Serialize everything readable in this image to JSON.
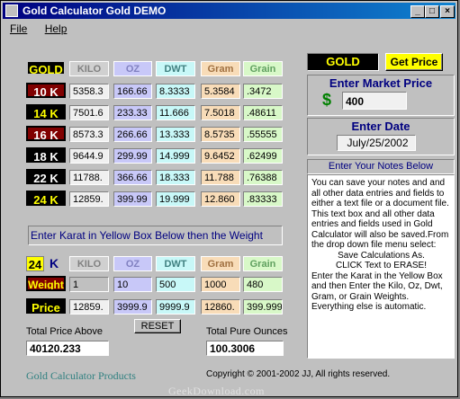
{
  "window": {
    "title": "Gold Calculator Gold DEMO"
  },
  "menu": {
    "file": "File",
    "help": "Help"
  },
  "table": {
    "gold_label": "GOLD",
    "headers": [
      "KILO",
      "OZ",
      "DWT",
      "Gram",
      "Grain"
    ],
    "rows": [
      {
        "karat": "10 K",
        "values": [
          "5358.3",
          "166.66",
          "8.3333",
          "5.3584",
          ".3472"
        ]
      },
      {
        "karat": "14 K",
        "values": [
          "7501.6",
          "233.33",
          "11.666",
          "7.5018",
          ".48611"
        ]
      },
      {
        "karat": "16 K",
        "values": [
          "8573.3",
          "266.66",
          "13.333",
          "8.5735",
          ".55555"
        ]
      },
      {
        "karat": "18 K",
        "values": [
          "9644.9",
          "299.99",
          "14.999",
          "9.6452",
          ".62499"
        ]
      },
      {
        "karat": "22 K",
        "values": [
          "11788.",
          "366.66",
          "18.333",
          "11.788",
          ".76388"
        ]
      },
      {
        "karat": "24 K",
        "values": [
          "12859.",
          "399.99",
          "19.999",
          "12.860",
          ".83333"
        ]
      }
    ]
  },
  "message": "Enter Karat in Yellow Box Below then the Weight",
  "input": {
    "karat_value": "24",
    "karat_unit": "K",
    "headers": [
      "KILO",
      "OZ",
      "DWT",
      "Gram",
      "Grain"
    ],
    "weight_label": "Weight",
    "weights": [
      "1",
      "10",
      "500",
      "1000",
      "480"
    ],
    "price_label": "Price",
    "prices": [
      "12859.",
      "3999.9",
      "9999.9",
      "12860.",
      "399.999"
    ]
  },
  "reset_label": "RESET",
  "totals": {
    "price_label": "Total Price Above",
    "price_value": "40120.233",
    "ounces_label": "Total Pure Ounces",
    "ounces_value": "100.3006"
  },
  "market": {
    "metal": "GOLD",
    "get_price": "Get Price",
    "title": "Enter Market Price",
    "currency": "$",
    "price": "400",
    "date_title": "Enter Date",
    "date": "July/25/2002",
    "notes_title": "Enter Your Notes Below"
  },
  "notes": {
    "lines": [
      "You can save your notes and and all other data entries and fields to either a text file or a document file. This text box and all other data entries and fields used in Gold Calculator will also be saved.From the drop down file menu select:",
      "Save Calculations As.",
      "CLICK Text to ERASE!",
      "Enter the Karat in the Yellow Box and then Enter the Kilo, Oz, Dwt, Gram, or Grain Weights.",
      "Everything else is automatic."
    ]
  },
  "footer": {
    "products": "Gold Calculator Products",
    "copyright": "Copyright © 2001-2002 JJ, All rights reserved.",
    "watermark": "GeekDownload.com"
  },
  "colors": {
    "title_bar": "#000080",
    "karat_10": "#800000",
    "karat_dark": "#000000",
    "gold_yellow": "#ffff00",
    "market_text": "#000080"
  }
}
